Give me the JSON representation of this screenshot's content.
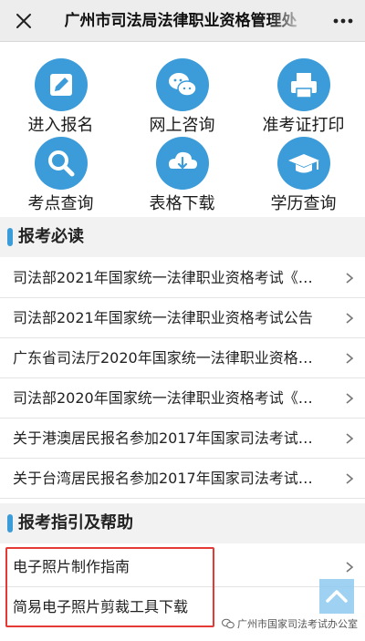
{
  "header": {
    "title": "广州市司法局法律职业资格管理处"
  },
  "menu": [
    {
      "label": "进入报名",
      "icon": "pencil-icon"
    },
    {
      "label": "网上咨询",
      "icon": "chat-icon"
    },
    {
      "label": "准考证打印",
      "icon": "printer-icon"
    },
    {
      "label": "考点查询",
      "icon": "search-icon"
    },
    {
      "label": "表格下载",
      "icon": "download-icon"
    },
    {
      "label": "学历查询",
      "icon": "graduation-cap-icon"
    }
  ],
  "section_notice": {
    "title": "报考必读",
    "items": [
      "司法部2021年国家统一法律职业资格考试《…",
      "司法部2021年国家统一法律职业资格考试公告",
      "广东省司法厅2020年国家统一法律职业资格…",
      "司法部2020年国家统一法律职业资格考试《…",
      "关于港澳居民报名参加2017年国家司法考试…",
      "关于台湾居民报名参加2017年国家司法考试…"
    ]
  },
  "section_guide": {
    "title": "报考指引及帮助",
    "items": [
      "电子照片制作指南",
      "简易电子照片剪裁工具下载"
    ]
  },
  "watermark": {
    "text": "广州市国家司法考试办公室"
  },
  "colors": {
    "accent": "#3b9cd9",
    "highlight": "#e53935"
  }
}
